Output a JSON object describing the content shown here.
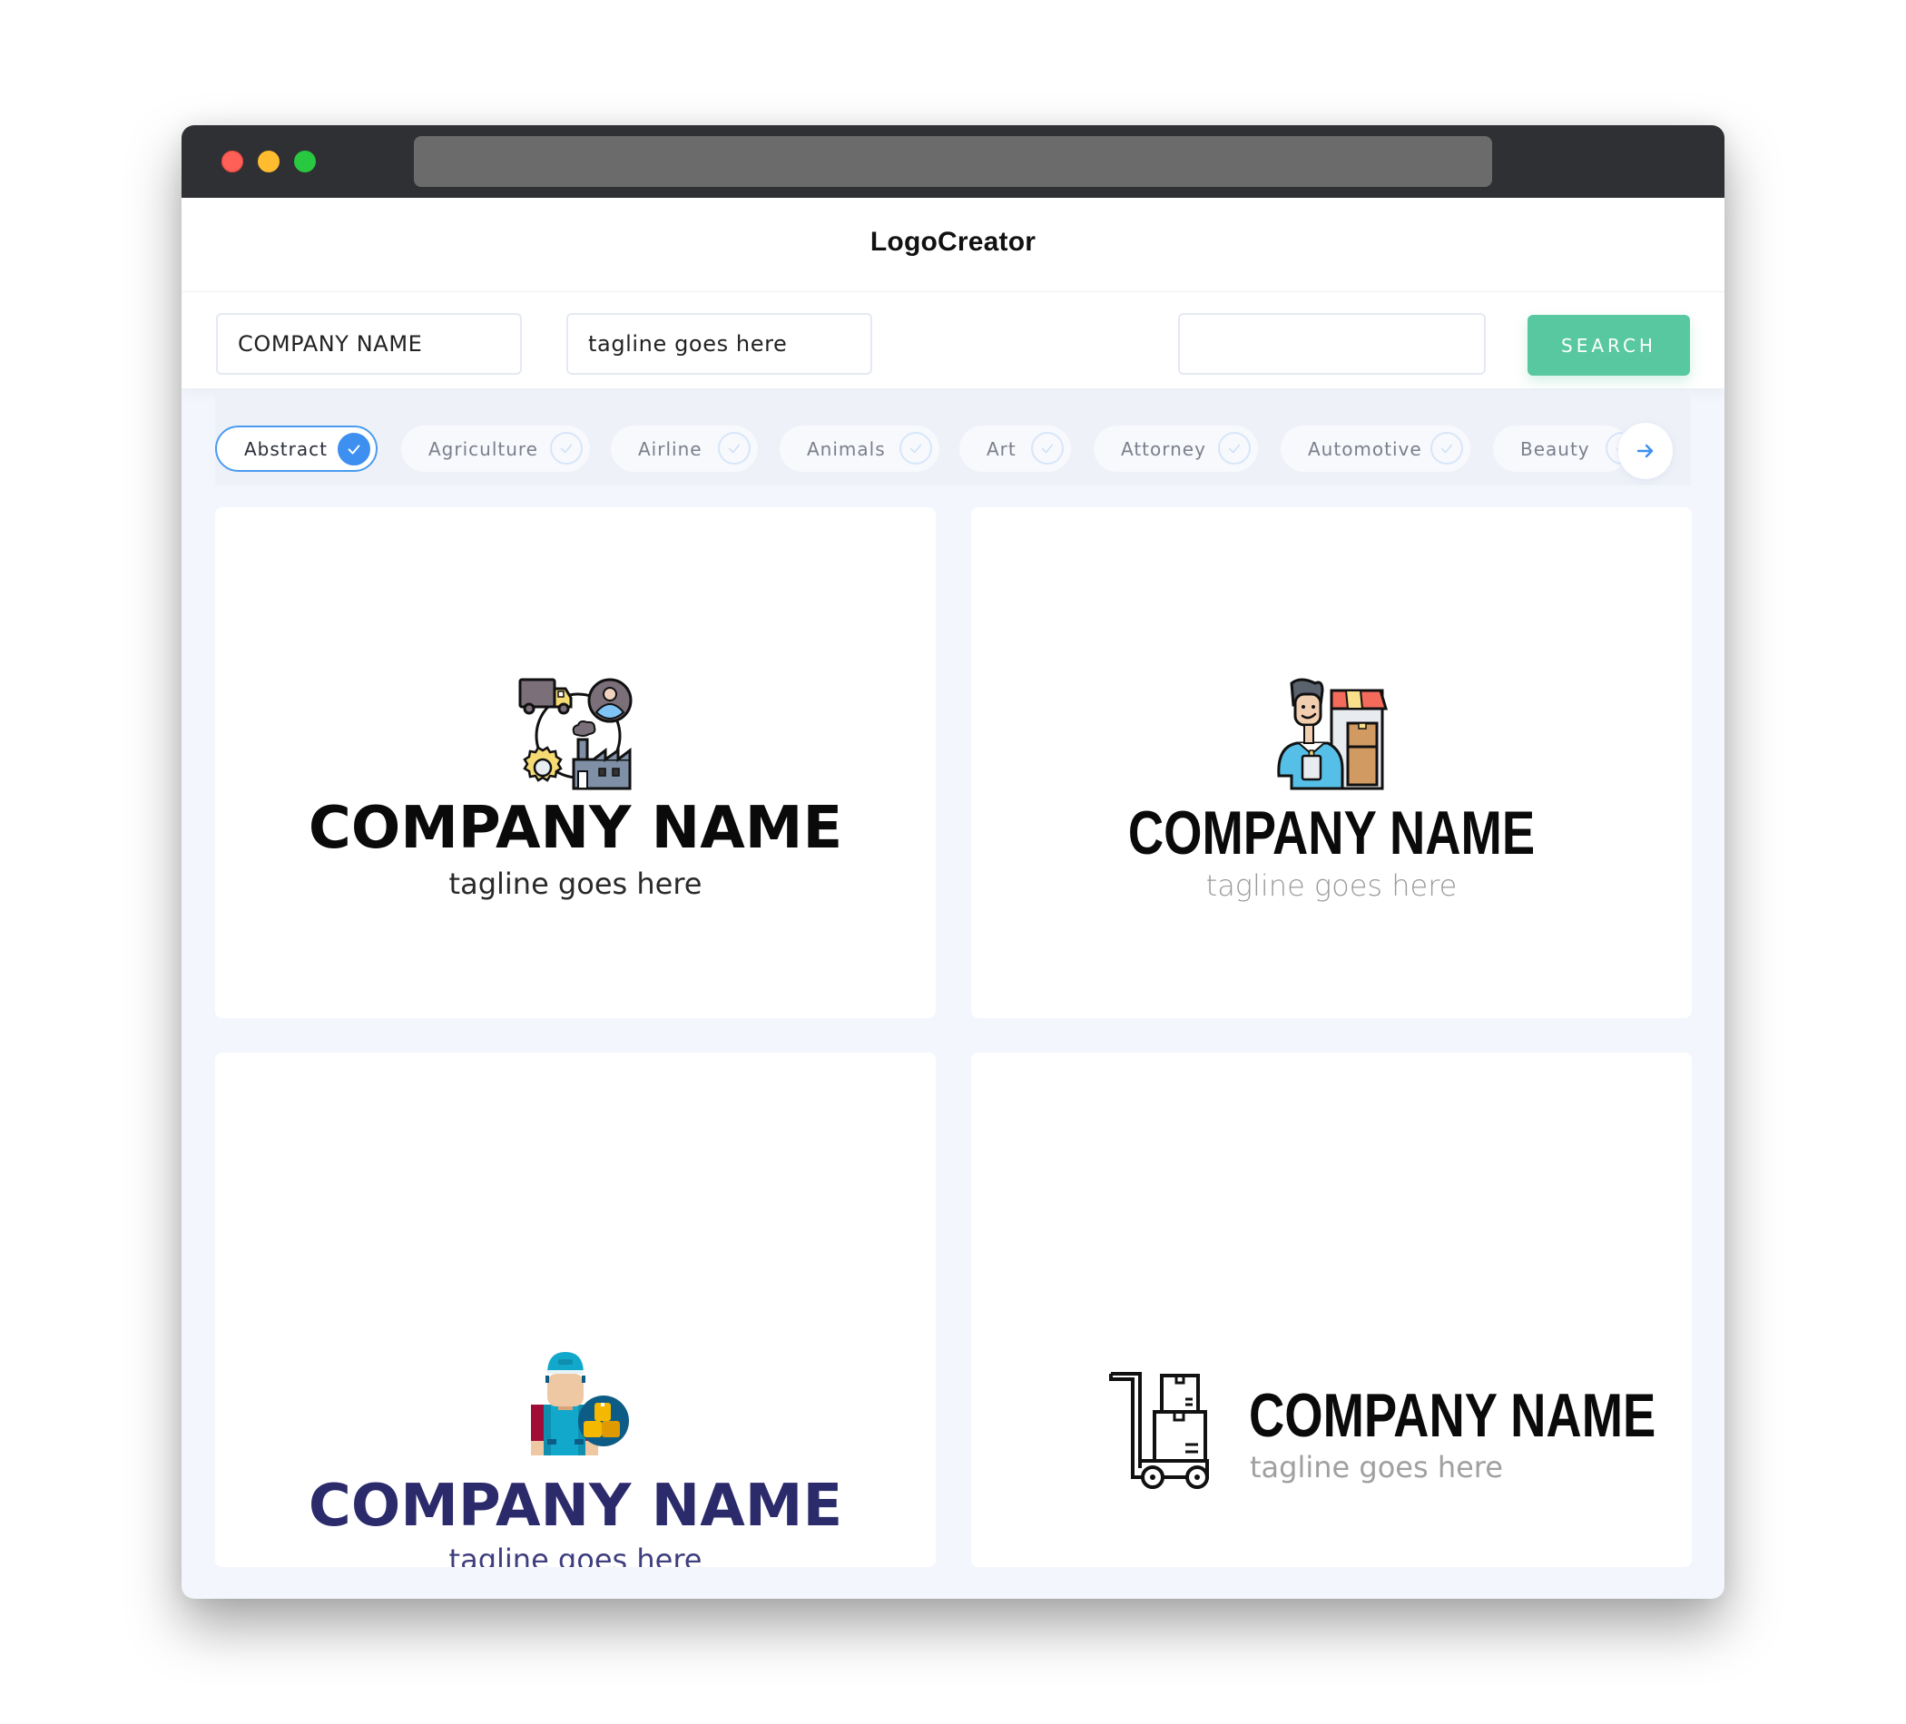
{
  "window": {
    "controls": [
      "close",
      "minimize",
      "maximize"
    ],
    "url": ""
  },
  "header": {
    "title": "LogoCreator"
  },
  "search": {
    "company_name_value": "COMPANY NAME",
    "tagline_value": "tagline goes here",
    "query_value": "",
    "button_label": "SEARCH",
    "button_color": "#58C8A0"
  },
  "categories": {
    "items": [
      {
        "label": "Abstract",
        "selected": true
      },
      {
        "label": "Agriculture",
        "selected": false
      },
      {
        "label": "Airline",
        "selected": false
      },
      {
        "label": "Animals",
        "selected": false
      },
      {
        "label": "Art",
        "selected": false
      },
      {
        "label": "Attorney",
        "selected": false
      },
      {
        "label": "Automotive",
        "selected": false
      },
      {
        "label": "Beauty",
        "selected": false
      }
    ],
    "next_icon": "arrow-right-icon",
    "accent_color": "#3D8FF0"
  },
  "results": [
    {
      "company": "COMPANY NAME",
      "tagline": "tagline goes here",
      "icon": "supply-chain-icon",
      "name_color": "#0A0A0A",
      "tagline_color": "#2A2A2A",
      "layout": "stacked"
    },
    {
      "company": "COMPANY NAME",
      "tagline": "tagline goes here",
      "icon": "shop-seller-icon",
      "name_color": "#0A0A0A",
      "tagline_color": "#9A9A9A",
      "layout": "stacked"
    },
    {
      "company": "COMPANY NAME",
      "tagline": "tagline goes here",
      "icon": "delivery-worker-icon",
      "name_color": "#2B2A6B",
      "tagline_color": "#3F3E7E",
      "layout": "stacked"
    },
    {
      "company": "COMPANY NAME",
      "tagline": "tagline goes here",
      "icon": "hand-truck-boxes-icon",
      "name_color": "#0A0A0A",
      "tagline_color": "#A0A0A0",
      "layout": "inline"
    }
  ]
}
